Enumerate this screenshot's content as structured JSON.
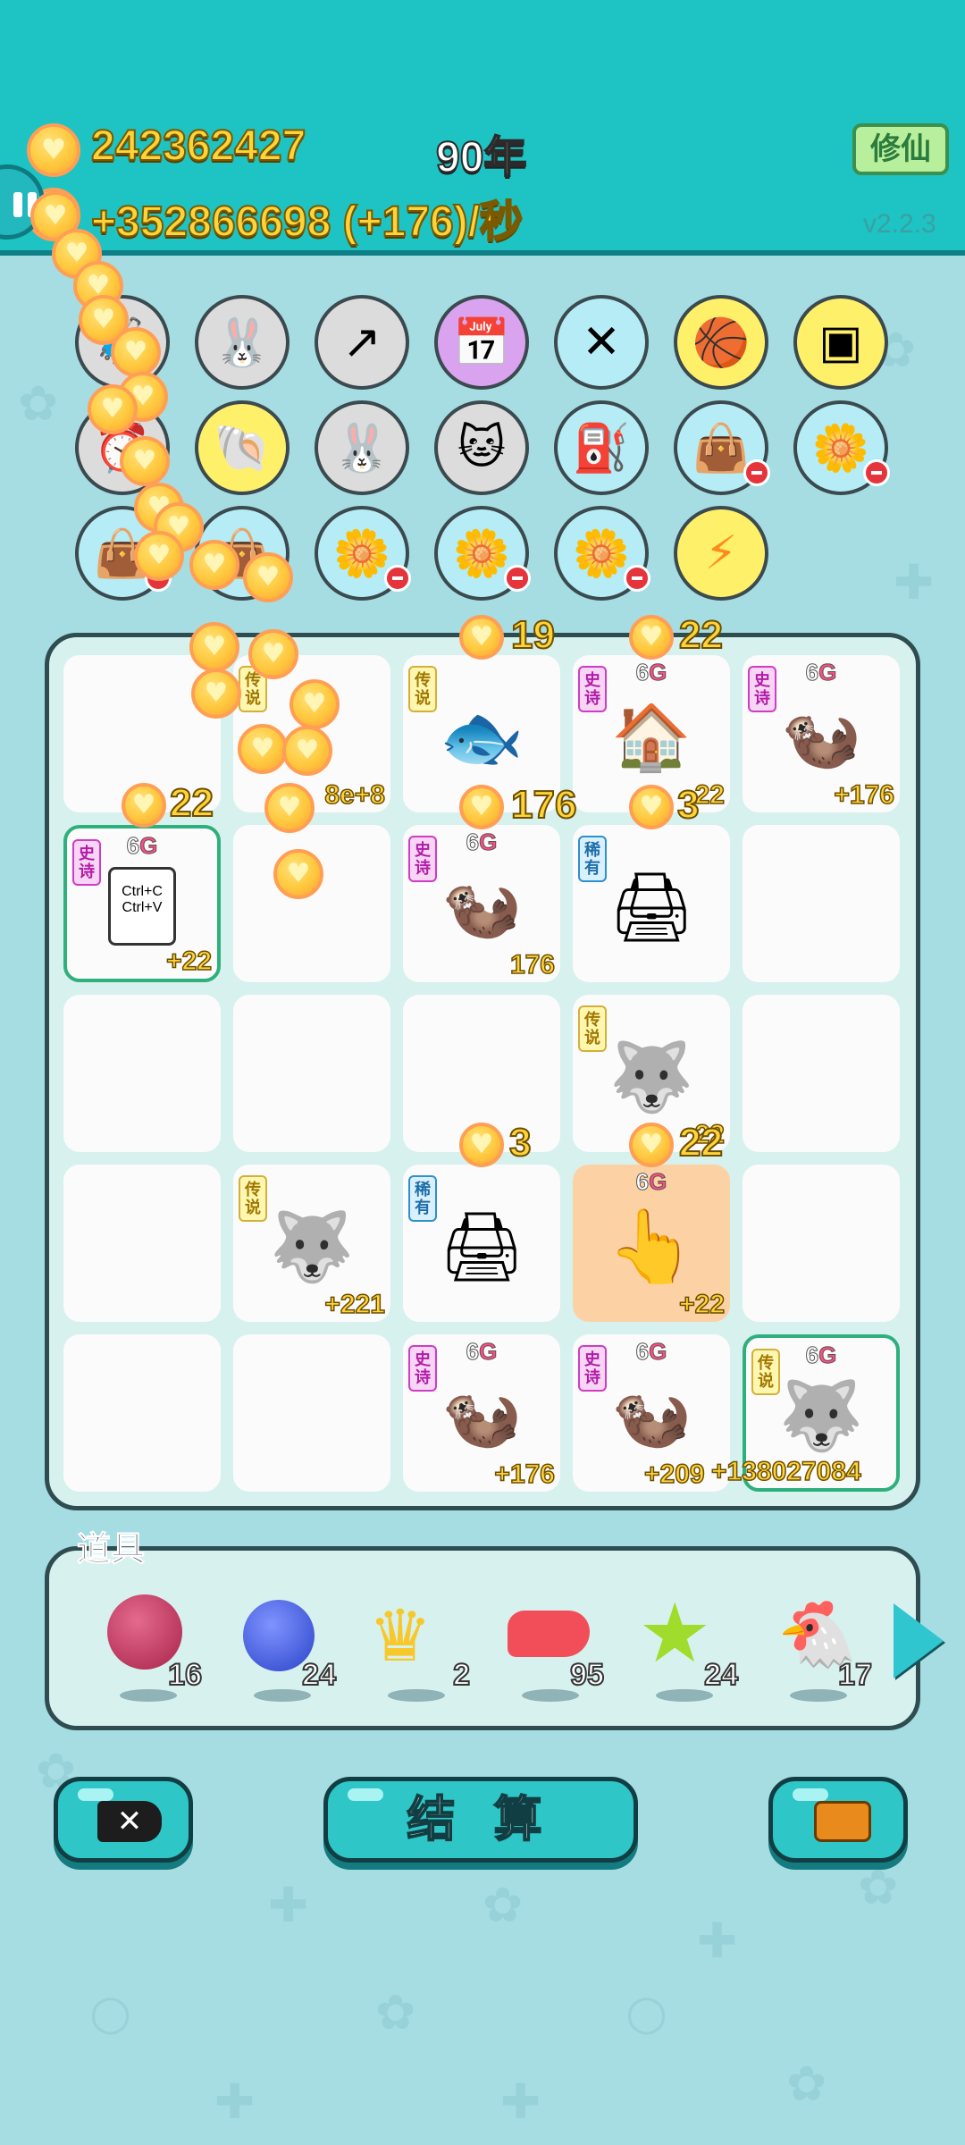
{
  "header": {
    "coins_total": "242362427",
    "income_line": "+352866698 (+176)/秒",
    "year": "90年",
    "cultivate_button": "修仙",
    "version": "v2.2.3"
  },
  "board": {
    "cells": [
      {
        "row": 0,
        "col": 1,
        "tag": "传说",
        "value": "8e+8"
      },
      {
        "row": 0,
        "col": 2,
        "tag": "传说"
      },
      {
        "row": 0,
        "col": 3,
        "tag": "史诗",
        "network": "6G",
        "value": "22"
      },
      {
        "row": 0,
        "col": 4,
        "tag": "史诗",
        "network": "6G",
        "value": "+176"
      },
      {
        "row": 1,
        "col": 0,
        "tag": "史诗",
        "network": "6G",
        "value": "+22",
        "item": "Ctrl+C Ctrl+V"
      },
      {
        "row": 1,
        "col": 2,
        "tag": "史诗",
        "network": "6G",
        "value": "176"
      },
      {
        "row": 1,
        "col": 3,
        "tag": "稀有"
      },
      {
        "row": 2,
        "col": 3,
        "tag": "传说",
        "value": "22"
      },
      {
        "row": 3,
        "col": 1,
        "tag": "传说",
        "value": "+221"
      },
      {
        "row": 3,
        "col": 2,
        "tag": "稀有"
      },
      {
        "row": 3,
        "col": 3,
        "network": "6G",
        "value": "+22"
      },
      {
        "row": 4,
        "col": 2,
        "tag": "史诗",
        "network": "6G",
        "value": "+176"
      },
      {
        "row": 4,
        "col": 3,
        "tag": "史诗",
        "network": "6G",
        "value": "+209"
      },
      {
        "row": 4,
        "col": 4,
        "tag": "传说",
        "network": "6G",
        "value": "+138027084"
      }
    ],
    "floating": [
      "22",
      "19",
      "22",
      "176",
      "3",
      "3",
      "22"
    ]
  },
  "props": {
    "title": "道具",
    "items": [
      {
        "name": "lychee",
        "count": "16"
      },
      {
        "name": "blueberry",
        "count": "24"
      },
      {
        "name": "crown",
        "count": "2"
      },
      {
        "name": "liver",
        "count": "95"
      },
      {
        "name": "star",
        "count": "24"
      },
      {
        "name": "chicken",
        "count": "17"
      }
    ]
  },
  "buttons": {
    "settle": "结 算"
  },
  "colors": {
    "header": "#1ec3c3",
    "background": "#a6dde3",
    "coin": "#ffd43a",
    "epic": "#cf3cc6",
    "legend": "#d2b13a",
    "rare": "#2f8fcf"
  }
}
